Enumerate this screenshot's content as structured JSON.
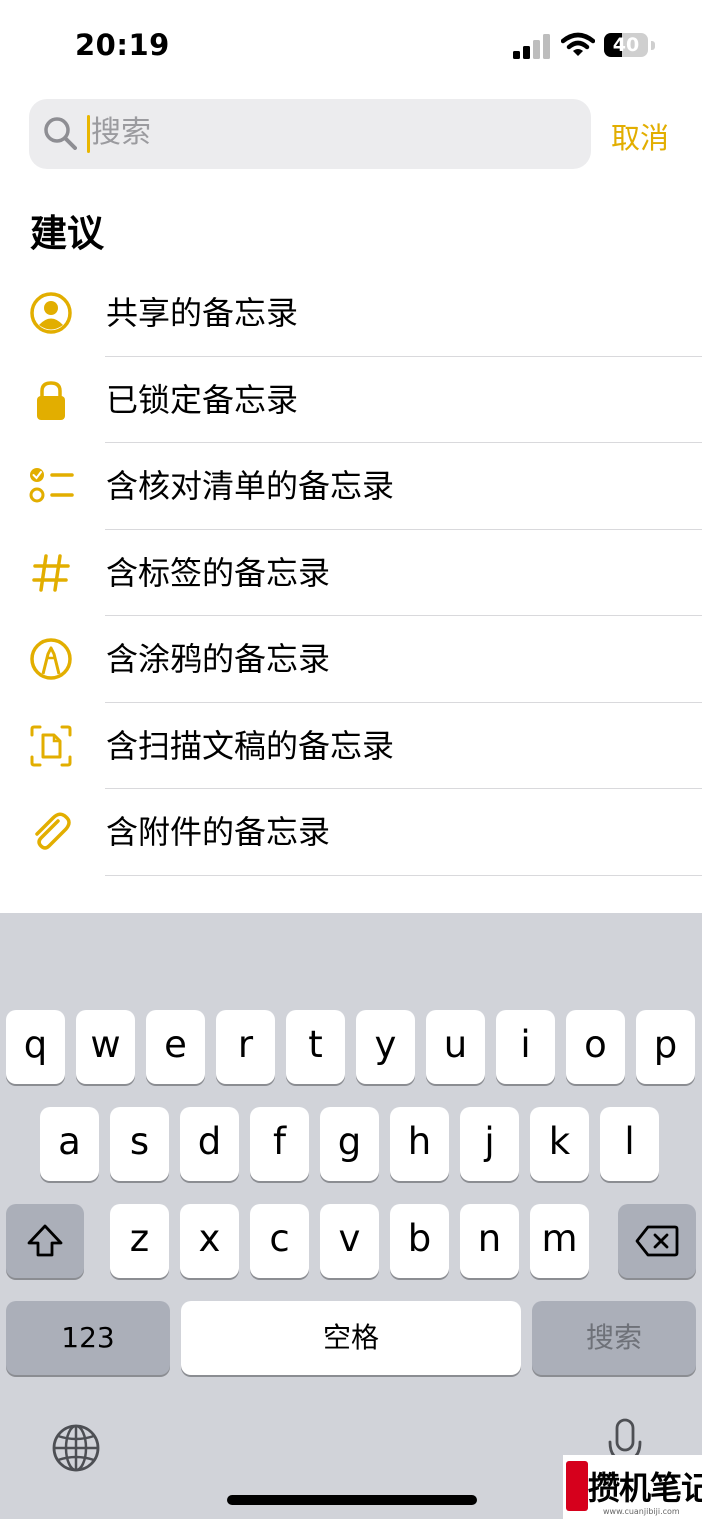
{
  "status_bar": {
    "time": "20:19",
    "battery_percent": "40",
    "battery_level": 0.4
  },
  "search": {
    "placeholder": "搜索",
    "cancel_label": "取消",
    "accent_color": "#E2AE00"
  },
  "suggestions": {
    "title": "建议",
    "items": [
      {
        "label": "共享的备忘录",
        "icon": "person-circle-icon"
      },
      {
        "label": "已锁定备忘录",
        "icon": "lock-icon"
      },
      {
        "label": "含核对清单的备忘录",
        "icon": "checklist-icon"
      },
      {
        "label": "含标签的备忘录",
        "icon": "hashtag-icon"
      },
      {
        "label": "含涂鸦的备忘录",
        "icon": "pencil-tip-circle-icon"
      },
      {
        "label": "含扫描文稿的备忘录",
        "icon": "doc-scan-icon"
      },
      {
        "label": "含附件的备忘录",
        "icon": "paperclip-icon"
      }
    ]
  },
  "keyboard": {
    "row1": [
      "q",
      "w",
      "e",
      "r",
      "t",
      "y",
      "u",
      "i",
      "o",
      "p"
    ],
    "row2": [
      "a",
      "s",
      "d",
      "f",
      "g",
      "h",
      "j",
      "k",
      "l"
    ],
    "row3": [
      "z",
      "x",
      "c",
      "v",
      "b",
      "n",
      "m"
    ],
    "numbers_label": "123",
    "space_label": "空格",
    "search_label": "搜索"
  },
  "watermark": {
    "text": "攒机笔记",
    "url": "www.cuanjibiji.com"
  }
}
